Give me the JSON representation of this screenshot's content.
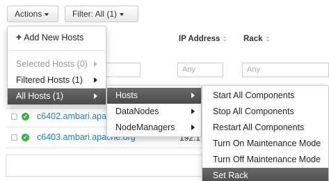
{
  "toolbar": {
    "actions_label": "Actions",
    "filter_label": "Filter:  All (1)"
  },
  "table": {
    "headers": {
      "ip": "IP Address",
      "rack": "Rack"
    },
    "filter_placeholder": "Any",
    "rows": [
      {
        "host": "c6402.ambari.apa",
        "ip": ""
      },
      {
        "host": "c6403.ambari.apache.org",
        "ip": "192.1"
      }
    ]
  },
  "actions_menu": {
    "add_new_hosts": "Add New Hosts",
    "selected_hosts": "Selected Hosts (0)",
    "filtered_hosts": "Filtered Hosts (1)",
    "all_hosts": "All Hosts (1)"
  },
  "all_hosts_menu": {
    "hosts": "Hosts",
    "datanodes": "DataNodes",
    "nodemanagers": "NodeManagers"
  },
  "hosts_menu": {
    "items": [
      "Start All Components",
      "Stop All Components",
      "Restart All Components",
      "Turn On Maintenance Mode",
      "Turn Off Maintenance Mode",
      "Set Rack"
    ]
  },
  "colors": {
    "link": "#2a7ab8",
    "status_ok": "#3fae49",
    "menu_active": "#555555"
  },
  "icons": {
    "add": "plus-icon",
    "submenu": "caret-right-icon",
    "status": "check-circle-icon"
  }
}
